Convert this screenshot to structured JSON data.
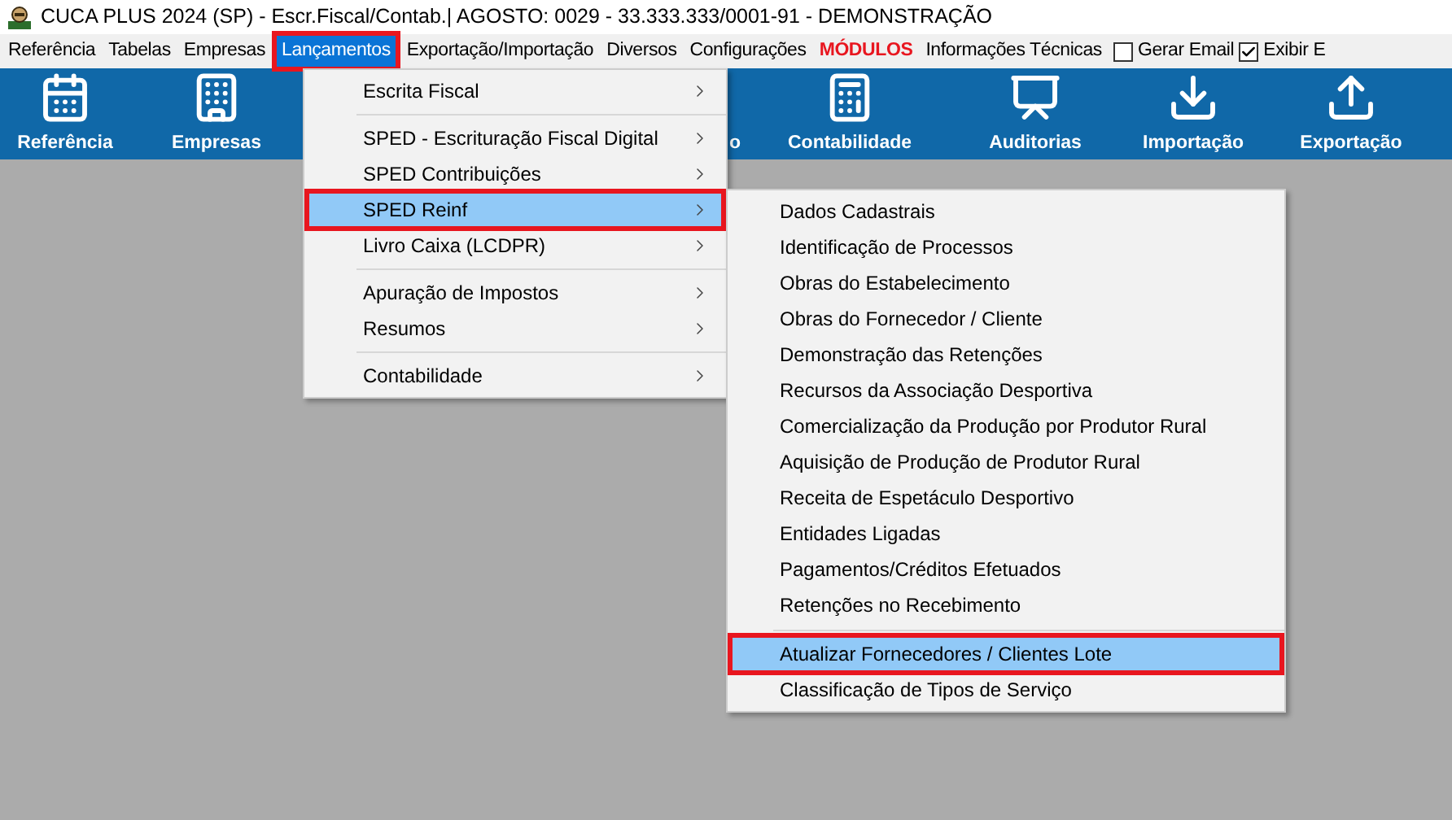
{
  "window": {
    "title": "CUCA PLUS 2024 (SP) - Escr.Fiscal/Contab.| AGOSTO: 0029 - 33.333.333/0001-91 - DEMONSTRAÇÃO"
  },
  "menubar": {
    "items": [
      {
        "label": "Referência",
        "kind": "menu",
        "selected": false,
        "annotated": false
      },
      {
        "label": "Tabelas",
        "kind": "menu",
        "selected": false,
        "annotated": false
      },
      {
        "label": "Empresas",
        "kind": "menu",
        "selected": false,
        "annotated": false
      },
      {
        "label": "Lançamentos",
        "kind": "menu",
        "selected": true,
        "annotated": true
      },
      {
        "label": "Exportação/Importação",
        "kind": "menu",
        "selected": false,
        "annotated": false
      },
      {
        "label": "Diversos",
        "kind": "menu",
        "selected": false,
        "annotated": false
      },
      {
        "label": "Configurações",
        "kind": "menu",
        "selected": false,
        "annotated": false
      },
      {
        "label": "MÓDULOS",
        "kind": "emphasis",
        "selected": false,
        "annotated": false
      },
      {
        "label": "Informações Técnicas",
        "kind": "menu",
        "selected": false,
        "annotated": false
      },
      {
        "label": "Gerar Email",
        "kind": "checkbox",
        "checked": false
      },
      {
        "label": "Exibir E",
        "kind": "checkbox",
        "checked": true
      }
    ]
  },
  "toolbar": {
    "items": [
      {
        "label": "Referência"
      },
      {
        "label": "Empresas"
      },
      {
        "label": "o"
      },
      {
        "label": "Contabilidade"
      },
      {
        "label": "Auditorias"
      },
      {
        "label": "Importação"
      },
      {
        "label": "Exportação"
      }
    ]
  },
  "menu": {
    "groups": [
      [
        {
          "label": "Escrita Fiscal",
          "selected": false,
          "annotated": false
        }
      ],
      [
        {
          "label": "SPED - Escrituração Fiscal Digital",
          "selected": false,
          "annotated": false
        },
        {
          "label": "SPED Contribuições",
          "selected": false,
          "annotated": false
        },
        {
          "label": "SPED Reinf",
          "selected": true,
          "annotated": true
        },
        {
          "label": "Livro Caixa (LCDPR)",
          "selected": false,
          "annotated": false
        }
      ],
      [
        {
          "label": "Apuração de Impostos",
          "selected": false,
          "annotated": false
        },
        {
          "label": "Resumos",
          "selected": false,
          "annotated": false
        }
      ],
      [
        {
          "label": "Contabilidade",
          "selected": false,
          "annotated": false
        }
      ]
    ]
  },
  "submenu": {
    "groups": [
      [
        {
          "label": "Dados Cadastrais",
          "selected": false,
          "annotated": false
        },
        {
          "label": "Identificação de Processos",
          "selected": false,
          "annotated": false
        },
        {
          "label": "Obras do Estabelecimento",
          "selected": false,
          "annotated": false
        },
        {
          "label": "Obras do Fornecedor / Cliente",
          "selected": false,
          "annotated": false
        },
        {
          "label": "Demonstração das Retenções",
          "selected": false,
          "annotated": false
        },
        {
          "label": "Recursos da Associação Desportiva",
          "selected": false,
          "annotated": false
        },
        {
          "label": "Comercialização da Produção por Produtor Rural",
          "selected": false,
          "annotated": false
        },
        {
          "label": "Aquisição de Produção de Produtor Rural",
          "selected": false,
          "annotated": false
        },
        {
          "label": "Receita de Espetáculo Desportivo",
          "selected": false,
          "annotated": false
        },
        {
          "label": "Entidades Ligadas",
          "selected": false,
          "annotated": false
        },
        {
          "label": "Pagamentos/Créditos Efetuados",
          "selected": false,
          "annotated": false
        },
        {
          "label": "Retenções no Recebimento",
          "selected": false,
          "annotated": false
        }
      ],
      [
        {
          "label": "Atualizar Fornecedores / Clientes Lote",
          "selected": true,
          "annotated": true
        },
        {
          "label": "Classificação de Tipos de Serviço",
          "selected": false,
          "annotated": false
        }
      ]
    ]
  }
}
